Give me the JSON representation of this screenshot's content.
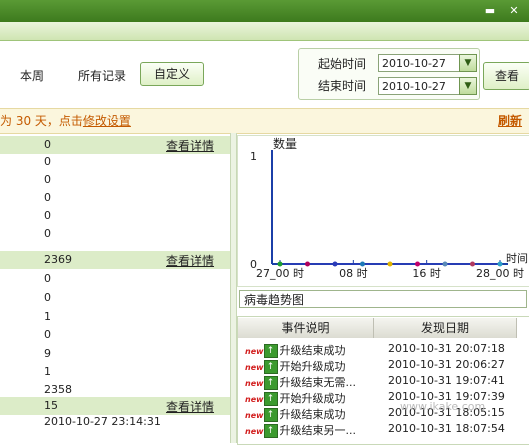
{
  "window": {
    "minimize_glyph": "▬",
    "close_glyph": "✕"
  },
  "filters": {
    "week": "本周",
    "all": "所有记录",
    "custom": "自定义"
  },
  "date_range": {
    "start_label": "起始时间",
    "start_value": "2010-10-27",
    "end_label": "结束时间",
    "end_value": "2010-10-27",
    "view_button": "查看"
  },
  "notice": {
    "prefix": "为 30 天，点击",
    "link": "修改设置",
    "refresh": "刷新"
  },
  "groups": [
    {
      "value": "0",
      "link": "查看详情",
      "rows": [
        "0",
        "0",
        "0",
        "0",
        "0"
      ]
    },
    {
      "value": "2369",
      "link": "查看详情",
      "rows": [
        "0",
        "0",
        "1",
        "0",
        "9",
        "1",
        "2358"
      ]
    },
    {
      "value": "15",
      "link": "查看详情",
      "rows": [
        "2010-10-27 23:14:31"
      ]
    }
  ],
  "chart_data": {
    "type": "line",
    "ylabel": "数量",
    "xlabel": "时间",
    "ylim": [
      0,
      1
    ],
    "y_ticks": [
      "1",
      "0"
    ],
    "x_ticks": [
      "27_00 时",
      "08 时",
      "16 时",
      "28_00 时"
    ],
    "x": [
      0,
      1,
      2,
      3,
      4,
      5,
      6,
      7,
      8
    ],
    "series": [
      {
        "values": [
          0,
          0,
          0,
          0,
          0,
          0,
          0,
          0,
          0
        ],
        "point_colors": [
          "#1e9e2f",
          "#b0005a",
          "#2a3bb8",
          "#1e7ab8",
          "#e0b400",
          "#c0006a",
          "#5a8ab8",
          "#b03a60",
          "#2ea0c8"
        ]
      }
    ],
    "grid": false,
    "legend": "none"
  },
  "chart_type_select": "病毒趋势图",
  "event_table": {
    "headers": [
      "事件说明",
      "发现日期"
    ],
    "new_tag": "new",
    "up_icon": "↑",
    "rows": [
      {
        "desc": "升级结束成功",
        "date": "2010-10-31 20:07:18"
      },
      {
        "desc": "开始升级成功",
        "date": "2010-10-31 20:06:27"
      },
      {
        "desc": "升级结束无需...",
        "date": "2010-10-31 19:07:41"
      },
      {
        "desc": "开始升级成功",
        "date": "2010-10-31 19:07:39"
      },
      {
        "desc": "升级结束成功",
        "date": "2010-10-31 18:05:15"
      },
      {
        "desc": "升级结束另一...",
        "date": "2010-10-31 18:07:54"
      }
    ]
  },
  "watermark": "www.ikake.com"
}
